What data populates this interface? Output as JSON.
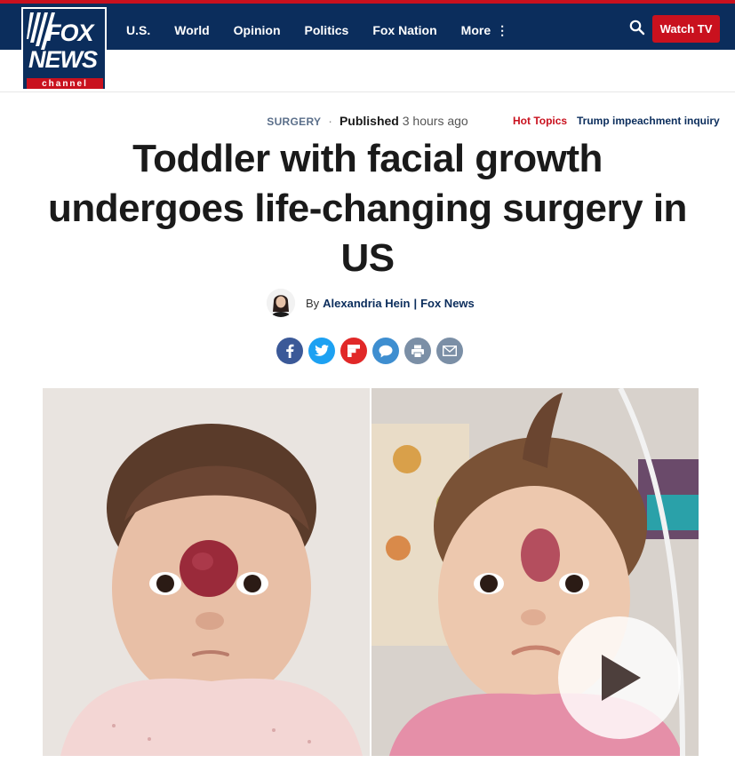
{
  "brand": {
    "logo_top": "FOX",
    "logo_mid": "NEWS",
    "logo_bottom": "channel",
    "colors": {
      "navy": "#0b2d5c",
      "red": "#c9111e"
    }
  },
  "nav": {
    "items": [
      {
        "label": "U.S."
      },
      {
        "label": "World"
      },
      {
        "label": "Opinion"
      },
      {
        "label": "Politics"
      },
      {
        "label": "Fox Nation"
      },
      {
        "label": "More"
      }
    ],
    "search_icon": "search-icon",
    "watch_label": "Watch TV"
  },
  "subnav": {
    "hot_topics": "Hot Topics",
    "trending": "Trump impeachment inquiry"
  },
  "article": {
    "category": "SURGERY",
    "separator": "·",
    "published_label": "Published",
    "published_time": "3 hours ago",
    "headline": "Toddler with facial growth undergoes life-changing surgery in US",
    "byline_prefix": "By",
    "author": "Alexandria Hein",
    "byline_pipe": "|",
    "outlet": "Fox News",
    "share": [
      {
        "icon": "facebook-icon",
        "color": "#3b5998"
      },
      {
        "icon": "twitter-icon",
        "color": "#1da1f2"
      },
      {
        "icon": "flipboard-icon",
        "color": "#e12828"
      },
      {
        "icon": "comment-icon",
        "color": "#3e8ed0"
      },
      {
        "icon": "print-icon",
        "color": "#7b8fa6"
      },
      {
        "icon": "email-icon",
        "color": "#7b8fa6"
      }
    ],
    "video_icon": "play-icon"
  }
}
